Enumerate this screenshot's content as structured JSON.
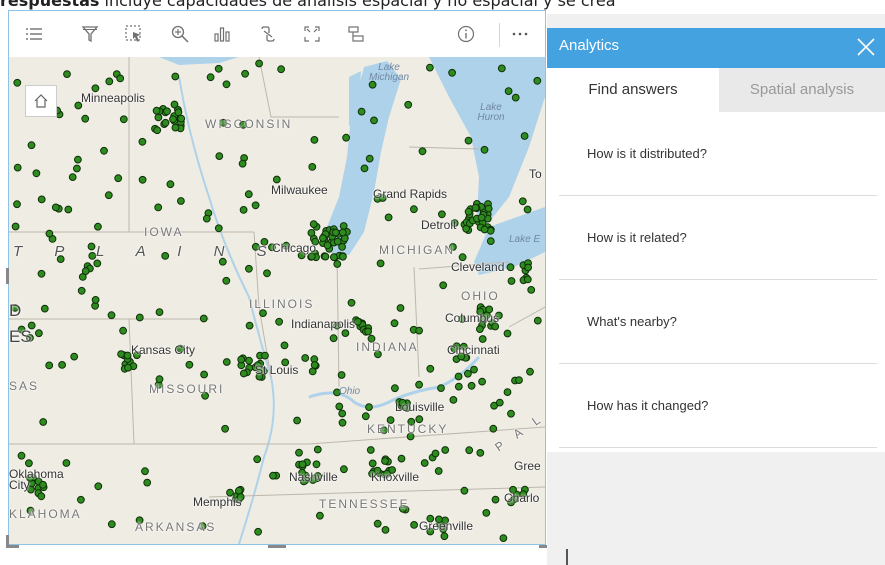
{
  "caption": {
    "bold": "respuestas",
    "text": " incluye capacidades de análisis espacial y no espacial y se crea"
  },
  "toolbar": {
    "icons": [
      "legend-icon",
      "filter-icon",
      "select-icon",
      "zoom-icon",
      "chart-icon",
      "connect-icon",
      "extent-icon",
      "layer-icon",
      "info-icon",
      "more-icon"
    ]
  },
  "map": {
    "cities": {
      "minneapolis": "Minneapolis",
      "milwaukee": "Milwaukee",
      "grand_rapids": "Grand Rapids",
      "detroit": "Detroit",
      "chicago": "Chicago",
      "cleveland": "Cleveland",
      "columbus": "Columbus",
      "indianapolis": "Indianapolis",
      "kansas_city": "Kansas City",
      "st_louis": "St Louis",
      "cincinnati": "Cincinnati",
      "louisville": "Louisville",
      "nashville": "Nashville",
      "knoxville": "Knoxville",
      "memphis": "Memphis",
      "oklahoma_city": "Oklahoma City",
      "greenville": "Greenville",
      "charlotte": "Charlo",
      "greensboro": "Gree",
      "toronto": "To"
    },
    "states": {
      "wisconsin": "WISCONSIN",
      "iowa": "IOWA",
      "michigan": "MICHIGAN",
      "ohio": "OHIO",
      "illinois": "ILLINOIS",
      "indiana": "INDIANA",
      "missouri": "MISSOURI",
      "kentucky": "KENTUCKY",
      "tennessee": "TENNESSEE",
      "arkansas": "ARKANSAS",
      "oklahoma": "KLAHOMA",
      "kansas": "SAS"
    },
    "region": {
      "plains": "T P L A I N S",
      "sd_1": "D",
      "sd_2": "ES",
      "appalachian": "P A L A C"
    },
    "water": {
      "lake_michigan": "Lake\nMichigan",
      "lake_huron": "Lake\nHuron",
      "lake_erie": "Lake E",
      "ohio_river": "Ohio"
    },
    "colors": {
      "dot": "#2e8b1f",
      "dot_stroke": "#0f2f08",
      "water": "#aed2ea",
      "land": "#efece4"
    }
  },
  "panel": {
    "title": "Analytics",
    "tabs": [
      "Find answers",
      "Spatial analysis"
    ],
    "questions": [
      "How is it distributed?",
      "How is it related?",
      "What's nearby?",
      "How has it changed?"
    ],
    "colors": {
      "header": "#45a2e0"
    }
  }
}
